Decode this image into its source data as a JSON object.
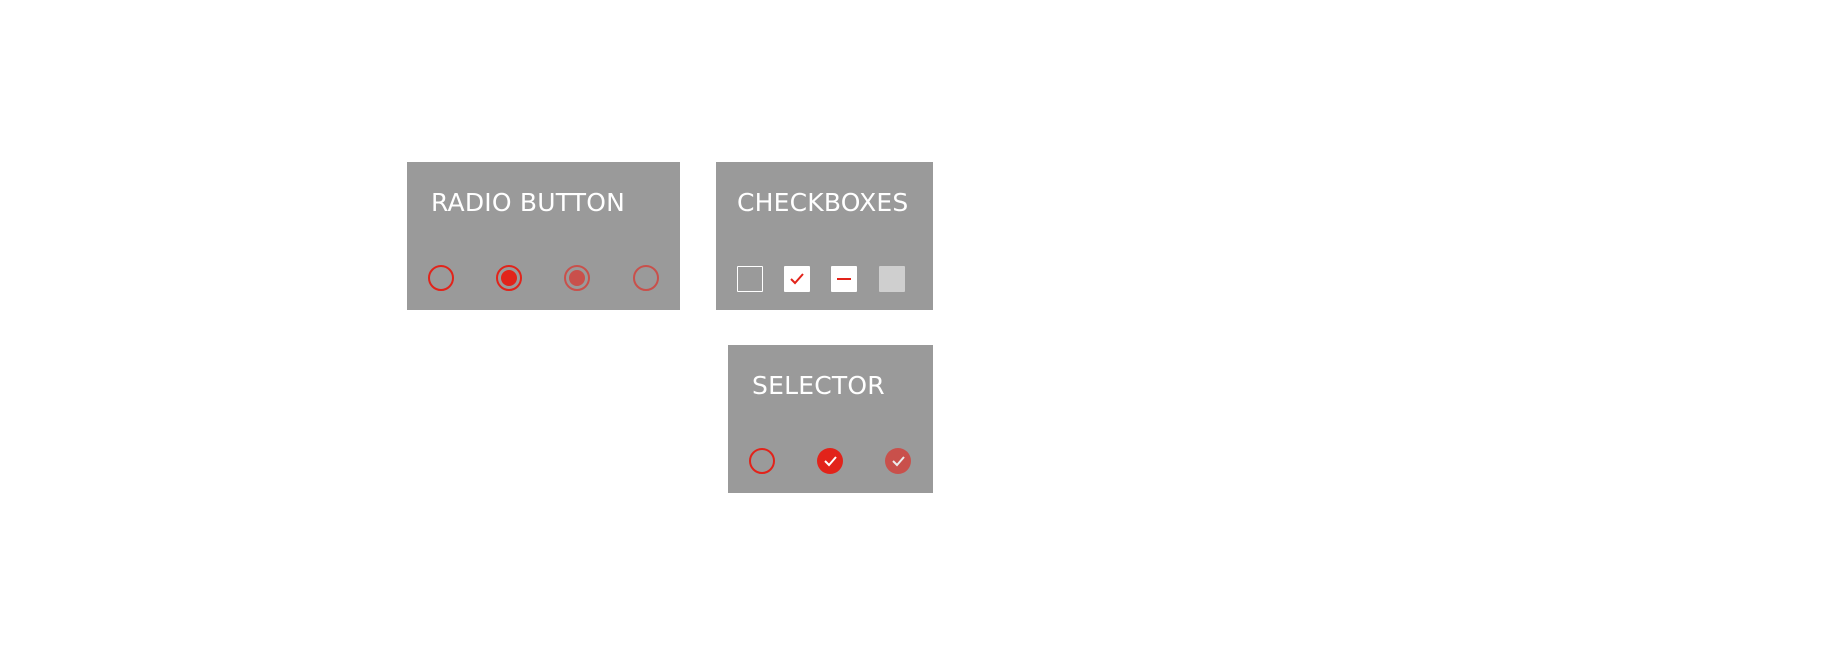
{
  "colors": {
    "panel_bg": "#9a9a9a",
    "accent_red": "#e2231a",
    "muted_red": "#c9504b",
    "disabled_fill": "#cfcfcf",
    "white": "#ffffff"
  },
  "radio_button": {
    "title": "RADIO BUTTON",
    "items": [
      {
        "state": "unselected",
        "icon": "radio-empty-icon"
      },
      {
        "state": "selected",
        "icon": "radio-selected-icon"
      },
      {
        "state": "selected-disabled",
        "icon": "radio-selected-disabled-icon"
      },
      {
        "state": "unselected-disabled",
        "icon": "radio-empty-disabled-icon"
      }
    ]
  },
  "checkboxes": {
    "title": "CHECKBOXES",
    "items": [
      {
        "state": "unchecked",
        "icon": "checkbox-empty-icon"
      },
      {
        "state": "checked",
        "icon": "check-icon"
      },
      {
        "state": "indeterminate",
        "icon": "minus-icon"
      },
      {
        "state": "disabled",
        "icon": "checkbox-disabled-icon"
      }
    ]
  },
  "selector": {
    "title": "SELECTOR",
    "items": [
      {
        "state": "unselected",
        "icon": "selector-empty-icon"
      },
      {
        "state": "selected",
        "icon": "check-icon"
      },
      {
        "state": "selected-disabled",
        "icon": "check-icon"
      }
    ]
  }
}
